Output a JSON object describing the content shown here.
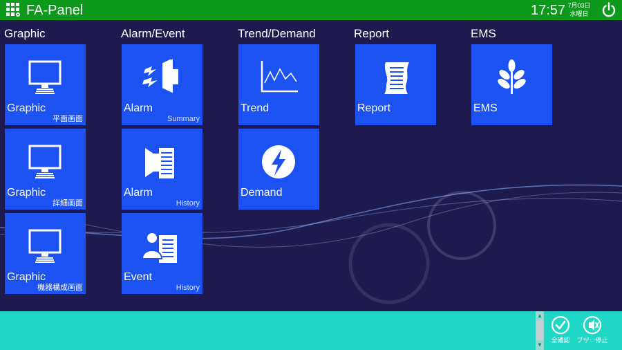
{
  "header": {
    "title": "FA-Panel",
    "time": "17:57",
    "date": "7月03日",
    "weekday": "水曜日"
  },
  "columns": [
    {
      "heading": "Graphic"
    },
    {
      "heading": "Alarm/Event"
    },
    {
      "heading": "Trend/Demand"
    },
    {
      "heading": "Report"
    },
    {
      "heading": "EMS"
    }
  ],
  "tiles": {
    "graphic_plan": {
      "label": "Graphic",
      "sub": "平面画面",
      "icon": "monitor-icon"
    },
    "graphic_detail": {
      "label": "Graphic",
      "sub": "詳細画面",
      "icon": "monitor-icon"
    },
    "graphic_equipment": {
      "label": "Graphic",
      "sub": "機器構成画面",
      "icon": "monitor-icon"
    },
    "alarm_summary": {
      "label": "Alarm",
      "sub": "Summary",
      "icon": "alarm-speaker-icon"
    },
    "alarm_history": {
      "label": "Alarm",
      "sub": "History",
      "icon": "alarm-history-icon"
    },
    "event_history": {
      "label": "Event",
      "sub": "History",
      "icon": "event-person-icon"
    },
    "trend": {
      "label": "Trend",
      "icon": "trend-chart-icon"
    },
    "demand": {
      "label": "Demand",
      "icon": "lightning-icon"
    },
    "report": {
      "label": "Report",
      "icon": "scroll-report-icon"
    },
    "ems": {
      "label": "EMS",
      "icon": "leaf-icon"
    }
  },
  "footer": {
    "confirm_all_label": "全確認",
    "buzzer_stop_label": "ブザー停止"
  },
  "colors": {
    "header": "#0d9a1c",
    "background": "#1e1a4e",
    "tile": "#1c52f2",
    "footer": "#20d6c4"
  }
}
